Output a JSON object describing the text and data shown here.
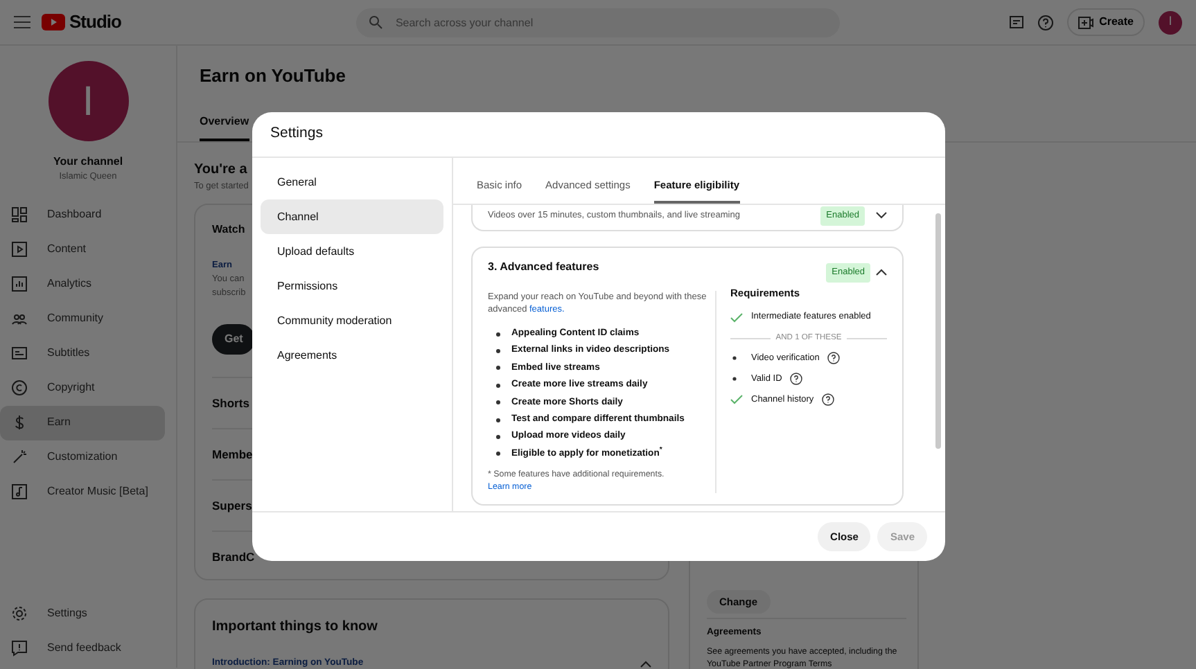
{
  "header": {
    "logo_text": "Studio",
    "search": {
      "placeholder": "Search across your channel"
    },
    "create_button": "Create",
    "avatar_initial": "I"
  },
  "sidebar": {
    "channel": {
      "avatar_initial": "I",
      "title": "Your channel",
      "name": "Islamic Queen"
    },
    "items": [
      {
        "label": "Dashboard",
        "selected": false
      },
      {
        "label": "Content",
        "selected": false
      },
      {
        "label": "Analytics",
        "selected": false
      },
      {
        "label": "Community",
        "selected": false
      },
      {
        "label": "Subtitles",
        "selected": false
      },
      {
        "label": "Copyright",
        "selected": false
      },
      {
        "label": "Earn",
        "selected": true
      },
      {
        "label": "Customization",
        "selected": false
      },
      {
        "label": "Creator Music [Beta]",
        "selected": false
      }
    ],
    "footer_items": [
      {
        "label": "Settings"
      },
      {
        "label": "Send feedback"
      }
    ]
  },
  "page": {
    "title": "Earn on YouTube",
    "tabs": [
      {
        "label": "Overview",
        "selected": true
      }
    ],
    "heading": "You're a",
    "subtitle": "To get started",
    "card": {
      "title": "Watch",
      "subtitle": "Earn",
      "text_lines": [
        "You can",
        "subscrib"
      ],
      "button": "Get",
      "rows": [
        "Shorts",
        "Membe",
        "Supers",
        "BrandC"
      ]
    },
    "important": {
      "title": "Important things to know",
      "item": "Introduction: Earning on YouTube",
      "expanded": true
    },
    "side_card": {
      "button": "Change",
      "section_title": "Agreements",
      "text": "See agreements you have accepted, including the YouTube Partner Program Terms"
    }
  },
  "modal": {
    "title": "Settings",
    "nav": [
      {
        "label": "General",
        "selected": false
      },
      {
        "label": "Channel",
        "selected": true
      },
      {
        "label": "Upload defaults",
        "selected": false
      },
      {
        "label": "Permissions",
        "selected": false
      },
      {
        "label": "Community moderation",
        "selected": false
      },
      {
        "label": "Agreements",
        "selected": false
      }
    ],
    "tabs": [
      {
        "label": "Basic info",
        "selected": false
      },
      {
        "label": "Advanced settings",
        "selected": false
      },
      {
        "label": "Feature eligibility",
        "selected": true
      }
    ],
    "features": [
      {
        "description": "Videos over 15 minutes, custom thumbnails, and live streaming",
        "badge": "Enabled",
        "expanded": false
      },
      {
        "title": "3. Advanced features",
        "badge": "Enabled",
        "expanded": true,
        "intro": "Expand your reach on YouTube and beyond with these advanced",
        "intro_link": "features.",
        "list": [
          "Appealing Content ID claims",
          "External links in video descriptions",
          "Embed live streams",
          "Create more live streams daily",
          "Create more Shorts daily",
          "Test and compare different thumbnails",
          "Upload more videos daily",
          "Eligible to apply for monetization$^{*}$"
        ],
        "footnote": "* Some features have additional requirements.",
        "footnote_link": "Learn more",
        "requirements_title": "Requirements",
        "requirements": [
          {
            "label": "Intermediate features enabled",
            "met": true,
            "help": false
          }
        ],
        "separator": "AND 1 OF THESE",
        "options": [
          {
            "label": "Video verification",
            "met": false,
            "help": true
          },
          {
            "label": "Valid ID",
            "met": false,
            "help": true
          },
          {
            "label": "Channel history",
            "met": true,
            "help": true
          }
        ]
      }
    ],
    "buttons": [
      {
        "label": "Close",
        "disabled": false
      },
      {
        "label": "Save",
        "disabled": true
      }
    ]
  }
}
